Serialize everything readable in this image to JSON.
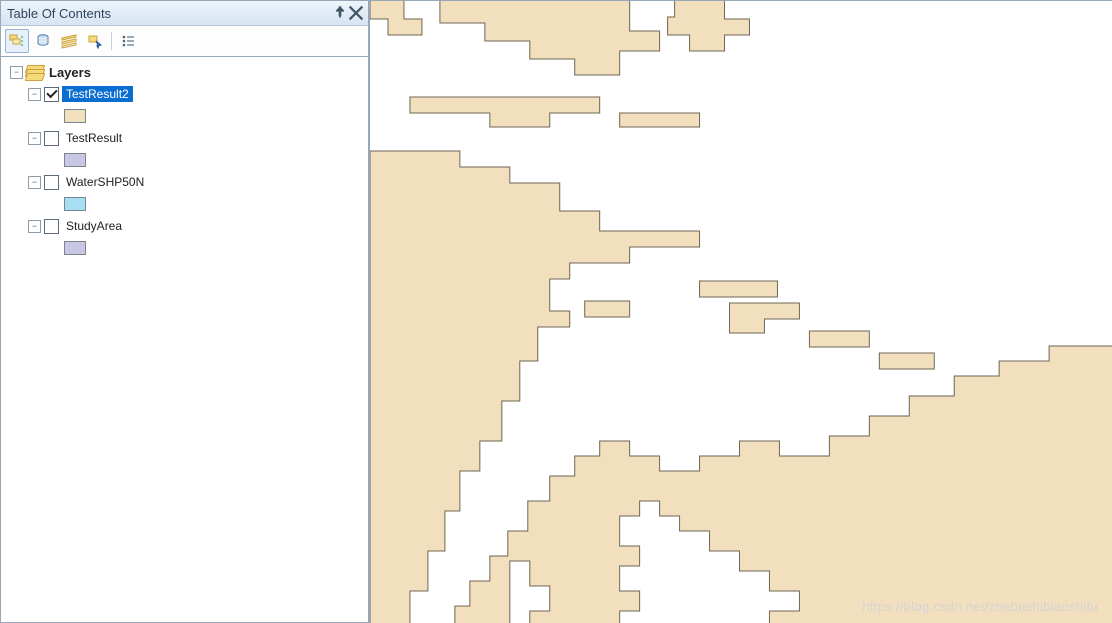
{
  "panel": {
    "title": "Table Of Contents",
    "pin_tooltip": "Auto Hide",
    "close_tooltip": "Close"
  },
  "toolbar": {
    "buttons": [
      {
        "name": "list-by-drawing-order",
        "active": true
      },
      {
        "name": "list-by-source",
        "active": false
      },
      {
        "name": "list-by-visibility",
        "active": false
      },
      {
        "name": "list-by-selection",
        "active": false
      },
      {
        "name": "options",
        "active": false
      }
    ]
  },
  "tree": {
    "root_label": "Layers",
    "items": [
      {
        "label": "TestResult2",
        "checked": true,
        "selected": true,
        "swatch": "#f2dfbd"
      },
      {
        "label": "TestResult",
        "checked": false,
        "selected": false,
        "swatch": "#cac6e4"
      },
      {
        "label": "WaterSHP50N",
        "checked": false,
        "selected": false,
        "swatch": "#a7def3"
      },
      {
        "label": "StudyArea",
        "checked": false,
        "selected": false,
        "swatch": "#cac6e4"
      }
    ]
  },
  "colors": {
    "feature_fill": "#f2dfbd",
    "feature_stroke": "#6f6654",
    "selection": "#0a6ed1"
  },
  "watermark": "https://blog.csdn.net/zhebushibiaoshifu"
}
